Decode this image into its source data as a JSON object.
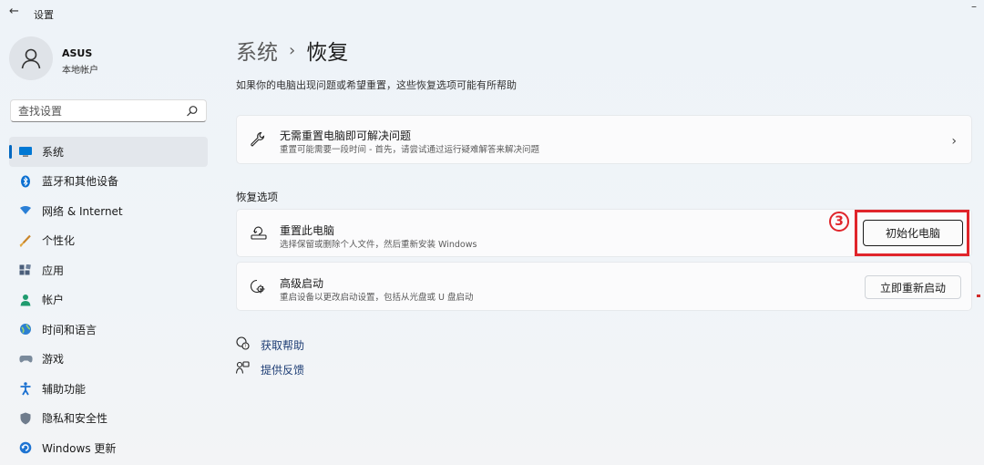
{
  "window": {
    "title": "设置",
    "back_glyph": "←",
    "minimize_glyph": "–"
  },
  "user": {
    "name": "ASUS",
    "account_type": "本地帐户"
  },
  "search": {
    "placeholder": "查找设置"
  },
  "sidebar": {
    "items": [
      {
        "label": "系统",
        "icon": "system-icon",
        "active": true
      },
      {
        "label": "蓝牙和其他设备",
        "icon": "bluetooth-icon"
      },
      {
        "label": "网络 & Internet",
        "icon": "network-icon"
      },
      {
        "label": "个性化",
        "icon": "personalization-icon"
      },
      {
        "label": "应用",
        "icon": "apps-icon"
      },
      {
        "label": "帐户",
        "icon": "accounts-icon"
      },
      {
        "label": "时间和语言",
        "icon": "time-language-icon"
      },
      {
        "label": "游戏",
        "icon": "gaming-icon"
      },
      {
        "label": "辅助功能",
        "icon": "accessibility-icon"
      },
      {
        "label": "隐私和安全性",
        "icon": "privacy-shield-icon"
      },
      {
        "label": "Windows 更新",
        "icon": "windows-update-icon"
      }
    ]
  },
  "breadcrumb": {
    "root": "系统",
    "separator": "›",
    "current": "恢复"
  },
  "description": "如果你的电脑出现问题或希望重置，这些恢复选项可能有所帮助",
  "troubleshoot": {
    "title": "无需重置电脑即可解决问题",
    "subtitle": "重置可能需要一段时间 - 首先，请尝试通过运行疑难解答来解决问题",
    "chevron": "›"
  },
  "recovery_section": {
    "heading": "恢复选项"
  },
  "reset_pc": {
    "title": "重置此电脑",
    "subtitle": "选择保留或删除个人文件，然后重新安装 Windows",
    "button_label": "初始化电脑",
    "step_marker": "3"
  },
  "advanced_startup": {
    "title": "高级启动",
    "subtitle": "重启设备以更改启动设置，包括从光盘或 U 盘启动",
    "button_label": "立即重新启动"
  },
  "links": {
    "get_help": "获取帮助",
    "give_feedback": "提供反馈"
  },
  "colors": {
    "accent": "#0067c0",
    "highlight": "#e0252b"
  }
}
